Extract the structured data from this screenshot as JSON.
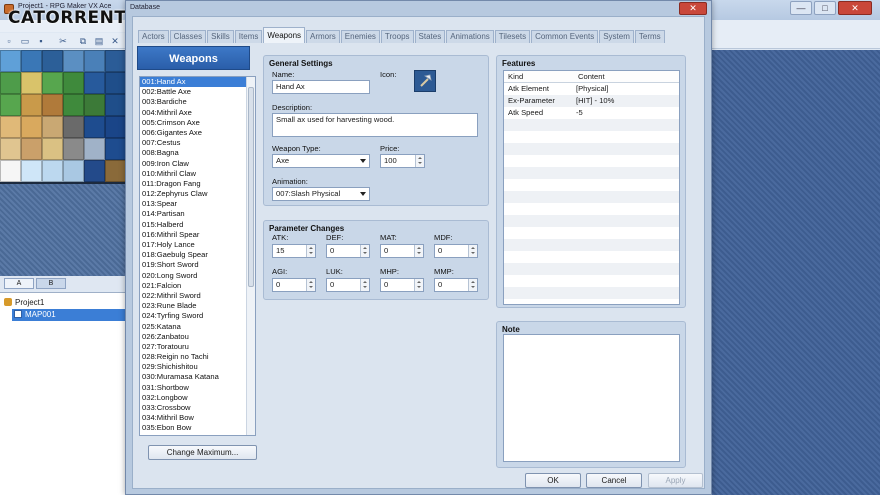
{
  "app": {
    "title": "Project1 - RPG Maker VX Ace",
    "watermark": "CATORRENT.ORG",
    "window_buttons": [
      "—",
      "□",
      "✕"
    ]
  },
  "tilesetColors": [
    "#5fa0d8",
    "#3a77b6",
    "#2c5f98",
    "#5b8fc2",
    "#4a80b8",
    "#2b5c97",
    "#4e9c4a",
    "#d9c36a",
    "#57a64e",
    "#3f8a3c",
    "#275a9c",
    "#1f4e8a",
    "#57a64e",
    "#c99a4a",
    "#b07a3a",
    "#3f8a3c",
    "#3c7a38",
    "#1f4e8a",
    "#e0b978",
    "#d9a95e",
    "#c9a873",
    "#6a6a6a",
    "#1e4c8f",
    "#1a4588",
    "#e0c590",
    "#caa06a",
    "#dac183",
    "#8a8a8a",
    "#a0b2c8",
    "#1e4c8f",
    "#f6f6f6",
    "#cfe6f8",
    "#bcd8ef",
    "#a9c8e3",
    "#234a8a",
    "#8a6a3a"
  ],
  "editor": {
    "tabs_ab": [
      "A",
      "B"
    ],
    "tree_root": "Project1",
    "tree_map": "MAP001"
  },
  "database": {
    "title": "Database",
    "tabs": [
      "Actors",
      "Classes",
      "Skills",
      "Items",
      "Weapons",
      "Armors",
      "Enemies",
      "Troops",
      "States",
      "Animations",
      "Tilesets",
      "Common Events",
      "System",
      "Terms"
    ],
    "active_tab": "Weapons",
    "list_title": "Weapons",
    "weapons": [
      "001:Hand Ax",
      "002:Battle Axe",
      "003:Bardiche",
      "004:Mithril Axe",
      "005:Crimson Axe",
      "006:Gigantes Axe",
      "007:Cestus",
      "008:Bagna",
      "009:Iron Claw",
      "010:Mithril Claw",
      "011:Dragon Fang",
      "012:Zephyrus Claw",
      "013:Spear",
      "014:Partisan",
      "015:Halberd",
      "016:Mithril Spear",
      "017:Holy Lance",
      "018:Gaebulg Spear",
      "019:Short Sword",
      "020:Long Sword",
      "021:Falcion",
      "022:Mithril Sword",
      "023:Rune Blade",
      "024:Tyrfing Sword",
      "025:Katana",
      "026:Zanbatou",
      "027:Toratouru",
      "028:Reigin no Tachi",
      "029:Shichishitou",
      "030:Muramasa Katana",
      "031:Shortbow",
      "032:Longbow",
      "033:Crossbow",
      "034:Mithril Bow",
      "035:Ebon Bow"
    ],
    "selected_index": 0,
    "change_max_label": "Change Maximum...",
    "general": {
      "title": "General Settings",
      "name_label": "Name:",
      "name_value": "Hand Ax",
      "icon_label": "Icon:",
      "description_label": "Description:",
      "description_value": "Small ax used for harvesting wood.",
      "weapon_type_label": "Weapon Type:",
      "weapon_type_value": "Axe",
      "price_label": "Price:",
      "price_value": "100",
      "animation_label": "Animation:",
      "animation_value": "007:Slash Physical"
    },
    "params": {
      "title": "Parameter Changes",
      "labels": [
        "ATK:",
        "DEF:",
        "MAT:",
        "MDF:",
        "AGI:",
        "LUK:",
        "MHP:",
        "MMP:"
      ],
      "values": [
        "15",
        "0",
        "0",
        "0",
        "0",
        "0",
        "0",
        "0"
      ]
    },
    "features": {
      "title": "Features",
      "col_kind": "Kind",
      "col_content": "Content",
      "rows": [
        {
          "kind": "Atk Element",
          "content": "[Physical]"
        },
        {
          "kind": "Ex-Parameter",
          "content": "[HIT] - 10%"
        },
        {
          "kind": "Atk Speed",
          "content": "-5"
        }
      ]
    },
    "note": {
      "title": "Note"
    },
    "buttons": {
      "ok": "OK",
      "cancel": "Cancel",
      "apply": "Apply"
    }
  }
}
